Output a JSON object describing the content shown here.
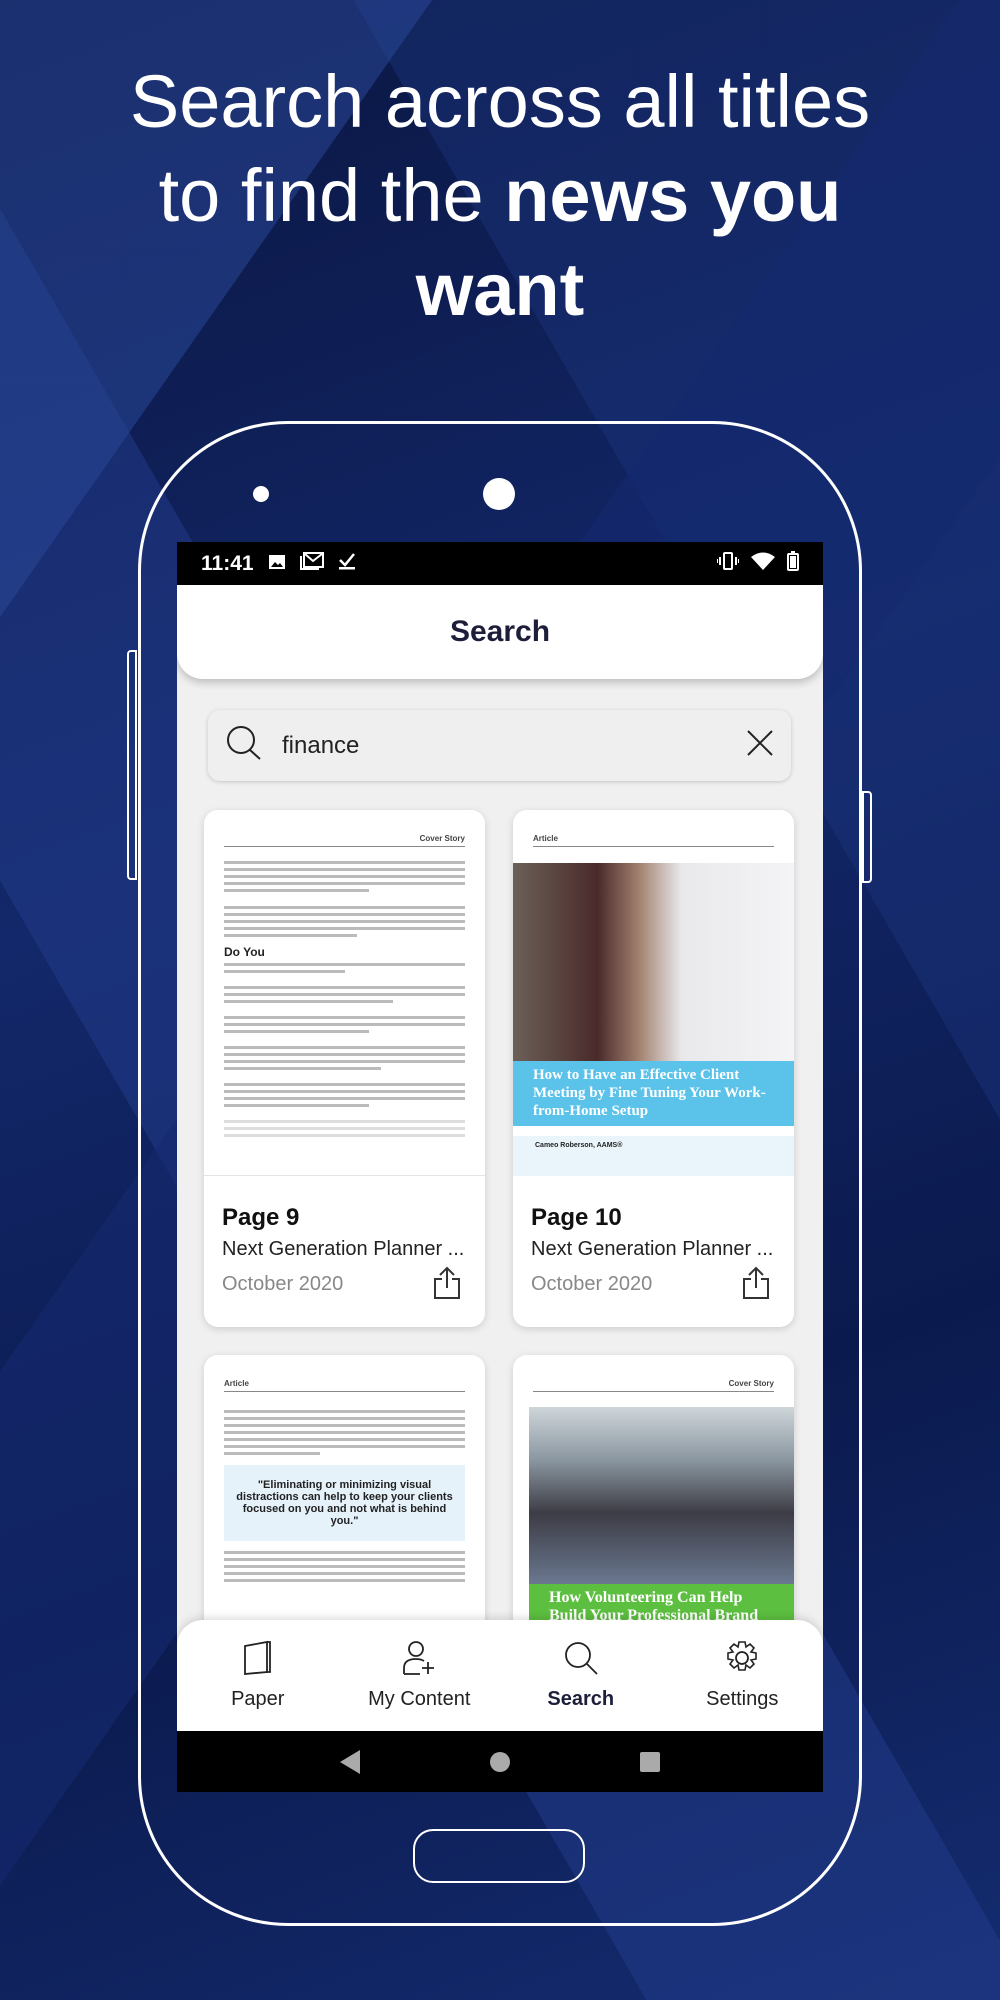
{
  "headline": {
    "line1": "Search across all titles",
    "line2_plain": "to find the ",
    "line2_bold": "news you",
    "line3_bold": "want"
  },
  "status_bar": {
    "time": "11:41",
    "icons": [
      "image-icon",
      "gmail-icon",
      "check-download-icon",
      "vibrate-icon",
      "wifi-icon",
      "battery-icon"
    ]
  },
  "header": {
    "title": "Search"
  },
  "search": {
    "value": "finance",
    "placeholder": "",
    "icon": "search-icon",
    "clear_icon": "close-icon"
  },
  "results": [
    {
      "page": "Page 9",
      "title": "Next Generation Planner ...",
      "date": "October 2020",
      "section": "Cover Story",
      "heading": "Do You"
    },
    {
      "page": "Page 10",
      "title": "Next Generation Planner ...",
      "date": "October 2020",
      "section": "Article",
      "banner": "How to Have an Effective Client Meeting by Fine Tuning Your Work-from-Home Setup",
      "banner_color": "#5bc2ea",
      "byline": "Cameo Roberson, AAMS®"
    },
    {
      "section": "Article",
      "quote": "\"Eliminating or minimizing visual distractions can help to keep your clients focused on you and not what is behind you.\""
    },
    {
      "section": "Cover Story",
      "banner": "How Volunteering Can Help Build Your Professional Brand",
      "banner_color": "#5cbf3f"
    }
  ],
  "bottom_nav": [
    {
      "label": "Paper",
      "icon": "paper-icon",
      "active": false
    },
    {
      "label": "My Content",
      "icon": "add-user-icon",
      "active": false
    },
    {
      "label": "Search",
      "icon": "search-icon",
      "active": true
    },
    {
      "label": "Settings",
      "icon": "gear-icon",
      "active": false
    }
  ],
  "colors": {
    "accent": "#1d1f3a",
    "background": "#0d1a45"
  }
}
